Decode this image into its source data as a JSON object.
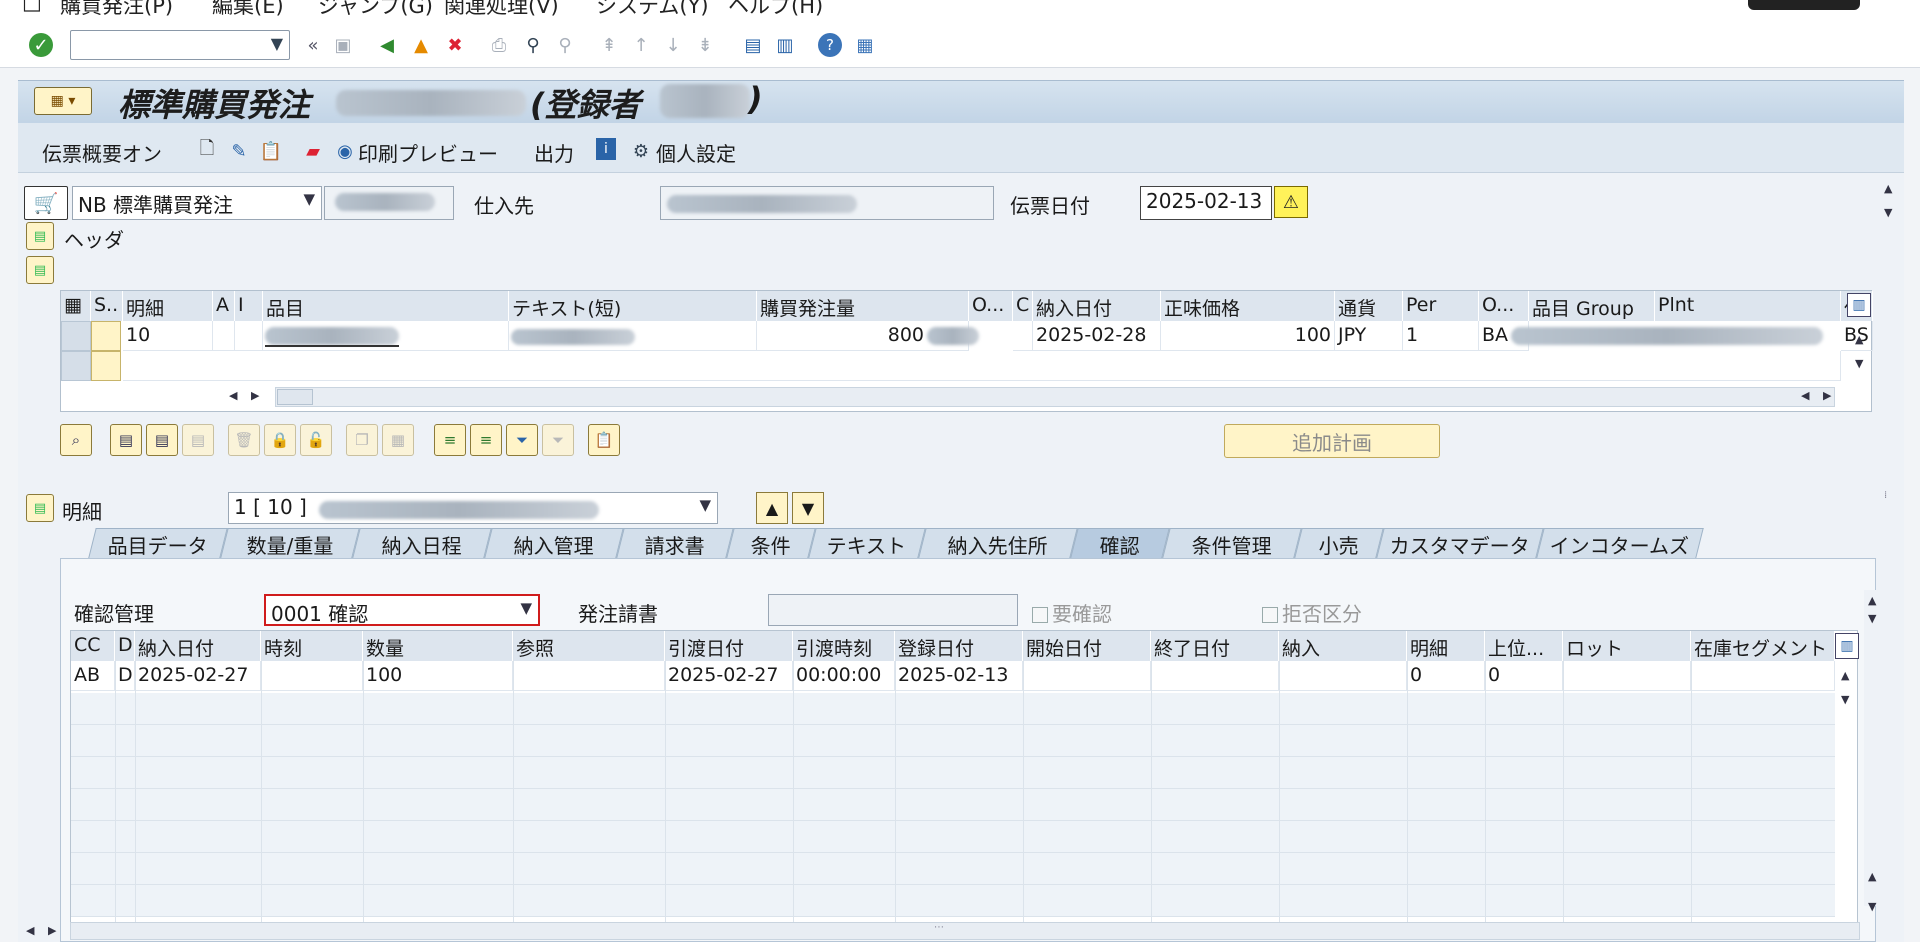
{
  "menu": {
    "items": [
      "購買発注(P)",
      "編集(E)",
      "ジャンプ(G)",
      "関連処理(V)",
      "システム(Y)",
      "ヘルプ(H)"
    ]
  },
  "title": {
    "main": "標準購買発注",
    "tail": "(登録者",
    "close_paren": ")"
  },
  "app_toolbar": {
    "summary_on": "伝票概要オン",
    "print_preview": "印刷プレビュー",
    "output": "出力",
    "personal_settings": "個人設定"
  },
  "header": {
    "doc_type": "NB 標準購買発注",
    "vendor_label": "仕入先",
    "doc_date_label": "伝票日付",
    "doc_date": "2025-02-13",
    "header_label": "ヘッダ"
  },
  "item_grid": {
    "columns": [
      "S..",
      "明細",
      "A",
      "I",
      "品目",
      "テキスト(短)",
      "購買発注量",
      "O...",
      "C",
      "納入日付",
      "正味価格",
      "通貨",
      "Per",
      "O...",
      "品目 Group",
      "Plnt",
      "保"
    ],
    "row": {
      "item": "10",
      "qty": "800",
      "delivery_date": "2025-02-28",
      "net_price": "100",
      "currency": "JPY",
      "per": "1",
      "order_unit": "BA",
      "storage": "BS"
    }
  },
  "add_plan_button": "追加計画",
  "detail": {
    "label": "明細",
    "selector": "1 [ 10 ]"
  },
  "tabs": [
    "品目データ",
    "数量/重量",
    "納入日程",
    "納入管理",
    "請求書",
    "条件",
    "テキスト",
    "納入先住所",
    "確認",
    "条件管理",
    "小売",
    "カスタマデータ",
    "インコタームズ"
  ],
  "confirmation": {
    "control_label": "確認管理",
    "control_value": "0001 確認",
    "ack_label": "発注請書",
    "ack_value": "",
    "req_confirm": "要確認",
    "reject_flag": "拒否区分"
  },
  "conf_grid": {
    "columns": [
      "CC",
      "D",
      "納入日付",
      "時刻",
      "数量",
      "参照",
      "引渡日付",
      "引渡時刻",
      "登録日付",
      "開始日付",
      "終了日付",
      "納入",
      "明細",
      "上位...",
      "ロット",
      "在庫セグメント"
    ],
    "row": {
      "cc": "AB",
      "d": "D",
      "delivery_date": "2025-02-27",
      "qty": "100",
      "handover_date": "2025-02-27",
      "handover_time": "00:00:00",
      "created_date": "2025-02-13",
      "item": "0",
      "parent": "0"
    }
  }
}
